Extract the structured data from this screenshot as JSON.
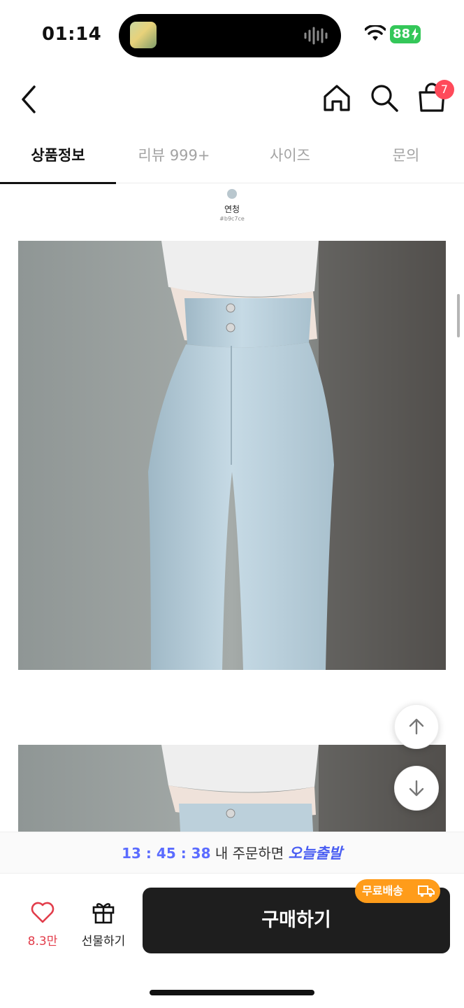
{
  "status": {
    "time": "01:14",
    "battery": "88"
  },
  "nav": {
    "cart_count": "7"
  },
  "tabs": [
    {
      "label": "상품정보",
      "active": true
    },
    {
      "label": "리뷰 999+",
      "active": false
    },
    {
      "label": "사이즈",
      "active": false
    },
    {
      "label": "문의",
      "active": false
    }
  ],
  "color_option": {
    "name": "연청",
    "hex": "#b9c7ce"
  },
  "delivery": {
    "countdown": "13 : 45 : 38",
    "order_text": " 내 주문하면 ",
    "today_ship": "오늘출발"
  },
  "actions": {
    "like_count": "8.3만",
    "gift_label": "선물하기",
    "buy_label": "구매하기",
    "free_ship_label": "무료배송"
  },
  "colors": {
    "accent": "#4a5ef2",
    "like": "#e23c4a",
    "badge": "#ff4a5a",
    "free_ship": "#ff9c1a",
    "buy": "#1e1e1e"
  },
  "icons": [
    "back-arrow-icon",
    "home-icon",
    "search-icon",
    "shopping-bag-icon",
    "arrow-up-icon",
    "arrow-down-icon",
    "heart-icon",
    "gift-icon",
    "truck-icon"
  ]
}
